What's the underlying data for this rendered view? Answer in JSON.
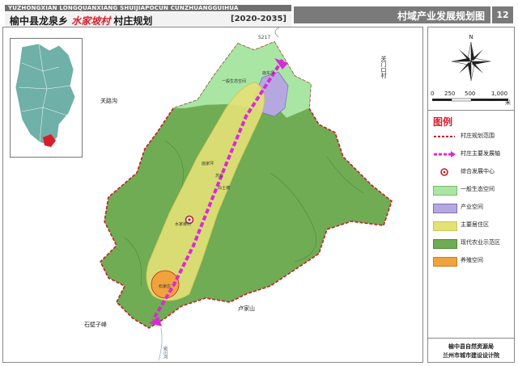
{
  "header": {
    "pinyin": "YUZHONGXIAN LONGQUANXIANG SHUIJIAPOCUN CUNZHUANGGUIHUA",
    "title_prefix": "榆中县龙泉乡",
    "title_highlight": "水家坡村",
    "title_suffix": "村庄规划",
    "years": "[2020-2035]",
    "map_name": "村域产业发展规划图",
    "sheet_no": "12"
  },
  "compass": {
    "north_label": "N"
  },
  "scale": {
    "ticks": [
      "0",
      "250",
      "500",
      "1,000"
    ],
    "unit": "米"
  },
  "legend": {
    "title": "图例",
    "items": [
      {
        "label": "村庄规划范围",
        "color": "#c0202a",
        "icon": "dashed-boundary-line"
      },
      {
        "label": "村庄主要发展轴",
        "color": "#d82ad8",
        "icon": "dashed-development-axis"
      },
      {
        "label": "综合发展中心",
        "color": "#c0202a",
        "icon": "ring-circle"
      },
      {
        "label": "一般生态空间",
        "color": "#a9e6a3",
        "icon": "fill-swatch"
      },
      {
        "label": "产业空间",
        "color": "#b5a8e0",
        "icon": "fill-swatch"
      },
      {
        "label": "主要居住区",
        "color": "#e4e176",
        "icon": "fill-swatch"
      },
      {
        "label": "现代农业示范区",
        "color": "#6fac53",
        "icon": "fill-swatch"
      },
      {
        "label": "养殖空间",
        "color": "#f0a23c",
        "icon": "fill-swatch"
      }
    ]
  },
  "map_labels": {
    "n_left": "关路沟",
    "s_left": "石壁子峰",
    "s_right": "卢家山",
    "e_top": "关门口村",
    "road": "S217",
    "center_village": "水家坡村",
    "north_node": "庙东坪",
    "south_node": "石家庄",
    "mid_node_a": "庙家坪",
    "mid_node_b": "苏泉",
    "mid_node_c": "白土坡",
    "eco_label": "一般生态空间",
    "river": "宛川河"
  },
  "org": {
    "line1": "榆中县自然资源局",
    "line2": "兰州市城市建设设计院"
  }
}
